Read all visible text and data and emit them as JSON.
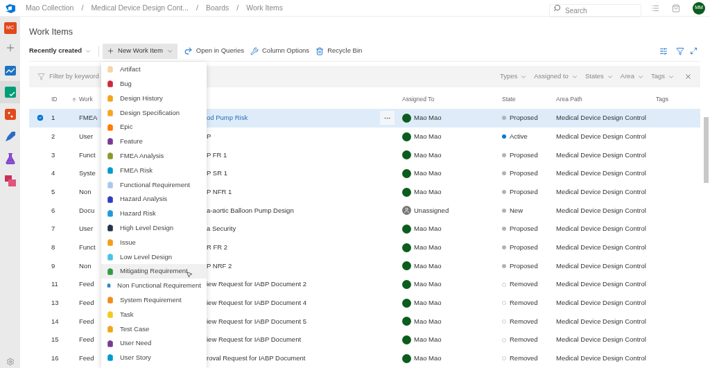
{
  "top_bar": {
    "breadcrumb": [
      "Mao Collection",
      "Medical Device Design Cont...",
      "Boards",
      "Work Items"
    ],
    "breadcrumb_separators": [
      "/",
      "/",
      "/"
    ],
    "search": {
      "placeholder": "Search"
    },
    "user_initials": "MM"
  },
  "sidebar": {
    "project_initials": "MC",
    "items": [
      {
        "kind": "plus",
        "selected": false
      },
      {
        "kind": "overview",
        "selected": false
      },
      {
        "kind": "boards",
        "selected": true
      },
      {
        "kind": "repos",
        "selected": false
      },
      {
        "kind": "pipelines",
        "selected": false
      },
      {
        "kind": "testplans",
        "selected": false
      },
      {
        "kind": "artifacts",
        "selected": false
      }
    ]
  },
  "page_title": "Work Items",
  "toolbar": {
    "view": "Recently created",
    "new_item": "New Work Item",
    "actions": [
      {
        "kind": "queries",
        "label": "Open in Queries"
      },
      {
        "kind": "columns",
        "label": "Column Options"
      },
      {
        "kind": "recycle",
        "label": "Recycle Bin"
      }
    ]
  },
  "filter_bar": {
    "placeholder": "Filter by keyword",
    "filters": [
      "Types",
      "Assigned to",
      "States",
      "Area",
      "Tags"
    ]
  },
  "table": {
    "columns": [
      "ID",
      "Work",
      "Assigned To",
      "State",
      "Area Path",
      "Tags"
    ],
    "rows": [
      {
        "id": "1",
        "type": "FMEA",
        "title": "od Pump Risk",
        "assigned": "Mao Mao",
        "unassigned": false,
        "state": "Proposed",
        "color": "#b2b2b2",
        "area": "Medical Device Design Control",
        "selected": true
      },
      {
        "id": "2",
        "type": "User",
        "title": "P",
        "assigned": "Mao Mao",
        "unassigned": false,
        "state": "Active",
        "color": "#007acc",
        "area": "Medical Device Design Control",
        "selected": false
      },
      {
        "id": "3",
        "type": "Funct",
        "title": "P FR 1",
        "assigned": "Mao Mao",
        "unassigned": false,
        "state": "Proposed",
        "color": "#b2b2b2",
        "area": "Medical Device Design Control",
        "selected": false
      },
      {
        "id": "4",
        "type": "Syste",
        "title": "P SR 1",
        "assigned": "Mao Mao",
        "unassigned": false,
        "state": "Proposed",
        "color": "#b2b2b2",
        "area": "Medical Device Design Control",
        "selected": false
      },
      {
        "id": "5",
        "type": "Non",
        "title": "P NFR 1",
        "assigned": "Mao Mao",
        "unassigned": false,
        "state": "Proposed",
        "color": "#b2b2b2",
        "area": "Medical Device Design Control",
        "selected": false
      },
      {
        "id": "6",
        "type": "Docu",
        "title": "a-aortic Balloon Pump Design",
        "assigned": "Unassigned",
        "unassigned": true,
        "state": "New",
        "color": "#b2b2b2",
        "area": "Medical Device Design Control",
        "selected": false
      },
      {
        "id": "7",
        "type": "User",
        "title": "a Security",
        "assigned": "Mao Mao",
        "unassigned": false,
        "state": "Proposed",
        "color": "#b2b2b2",
        "area": "Medical Device Design Control",
        "selected": false
      },
      {
        "id": "8",
        "type": "Funct",
        "title": "R FR 2",
        "assigned": "Mao Mao",
        "unassigned": false,
        "state": "Proposed",
        "color": "#b2b2b2",
        "area": "Medical Device Design Control",
        "selected": false
      },
      {
        "id": "9",
        "type": "Non",
        "title": "P NRF 2",
        "assigned": "Mao Mao",
        "unassigned": false,
        "state": "Proposed",
        "color": "#b2b2b2",
        "area": "Medical Device Design Control",
        "selected": false
      },
      {
        "id": "11",
        "type": "Feed",
        "title": "iew Request for IABP Document 2",
        "assigned": "Mao Mao",
        "unassigned": false,
        "state": "Removed",
        "color": "#ffffff",
        "area": "Medical Device Design Control",
        "selected": false
      },
      {
        "id": "13",
        "type": "Feed",
        "title": "iew Request for IABP Document 4",
        "assigned": "Mao Mao",
        "unassigned": false,
        "state": "Removed",
        "color": "#ffffff",
        "area": "Medical Device Design Control",
        "selected": false
      },
      {
        "id": "14",
        "type": "Feed",
        "title": "iew Request for IABP Document 5",
        "assigned": "Mao Mao",
        "unassigned": false,
        "state": "Removed",
        "color": "#ffffff",
        "area": "Medical Device Design Control",
        "selected": false
      },
      {
        "id": "15",
        "type": "Feed",
        "title": "iew Request for IABP Document",
        "assigned": "Mao Mao",
        "unassigned": false,
        "state": "Removed",
        "color": "#ffffff",
        "area": "Medical Device Design Control",
        "selected": false
      },
      {
        "id": "16",
        "type": "Feed",
        "title": "roval Request for IABP Document",
        "assigned": "Mao Mao",
        "unassigned": false,
        "state": "Removed",
        "color": "#ffffff",
        "area": "Medical Device Design Control",
        "selected": false
      }
    ]
  },
  "new_item_menu": [
    {
      "label": "Artifact",
      "color": "#f9d3a4",
      "selected": false
    },
    {
      "label": "Bug",
      "color": "#cc293d",
      "selected": false
    },
    {
      "label": "Design History",
      "color": "#f2a51c",
      "selected": false
    },
    {
      "label": "Design Specification",
      "color": "#f5a623",
      "selected": false
    },
    {
      "label": "Epic",
      "color": "#ff7b00",
      "selected": false
    },
    {
      "label": "Feature",
      "color": "#773b93",
      "selected": false
    },
    {
      "label": "FMEA Analysis",
      "color": "#8a9a2c",
      "selected": false
    },
    {
      "label": "FMEA Risk",
      "color": "#009ccc",
      "selected": false
    },
    {
      "label": "Functional Requirement",
      "color": "#a9c8ec",
      "selected": false
    },
    {
      "label": "Hazard Analysis",
      "color": "#2c3fbf",
      "selected": false
    },
    {
      "label": "Hazard Risk",
      "color": "#1e9bd7",
      "selected": false
    },
    {
      "label": "High Level Design",
      "color": "#24354a",
      "selected": false
    },
    {
      "label": "Issue",
      "color": "#f29d1c",
      "selected": false
    },
    {
      "label": "Low Level Design",
      "color": "#4cc3e0",
      "selected": false
    },
    {
      "label": "Mitigating Requirement",
      "color": "#339947",
      "selected": true
    },
    {
      "label": "Non Functional Requirement",
      "color": "#2e86c9",
      "selected": false
    },
    {
      "label": "System Requirement",
      "color": "#f08c1c",
      "selected": false
    },
    {
      "label": "Task",
      "color": "#f2cb1d",
      "selected": false
    },
    {
      "label": "Test Case",
      "color": "#f2a51c",
      "selected": false
    },
    {
      "label": "User Need",
      "color": "#773b93",
      "selected": false
    },
    {
      "label": "User Story",
      "color": "#009ccc",
      "selected": false
    }
  ]
}
